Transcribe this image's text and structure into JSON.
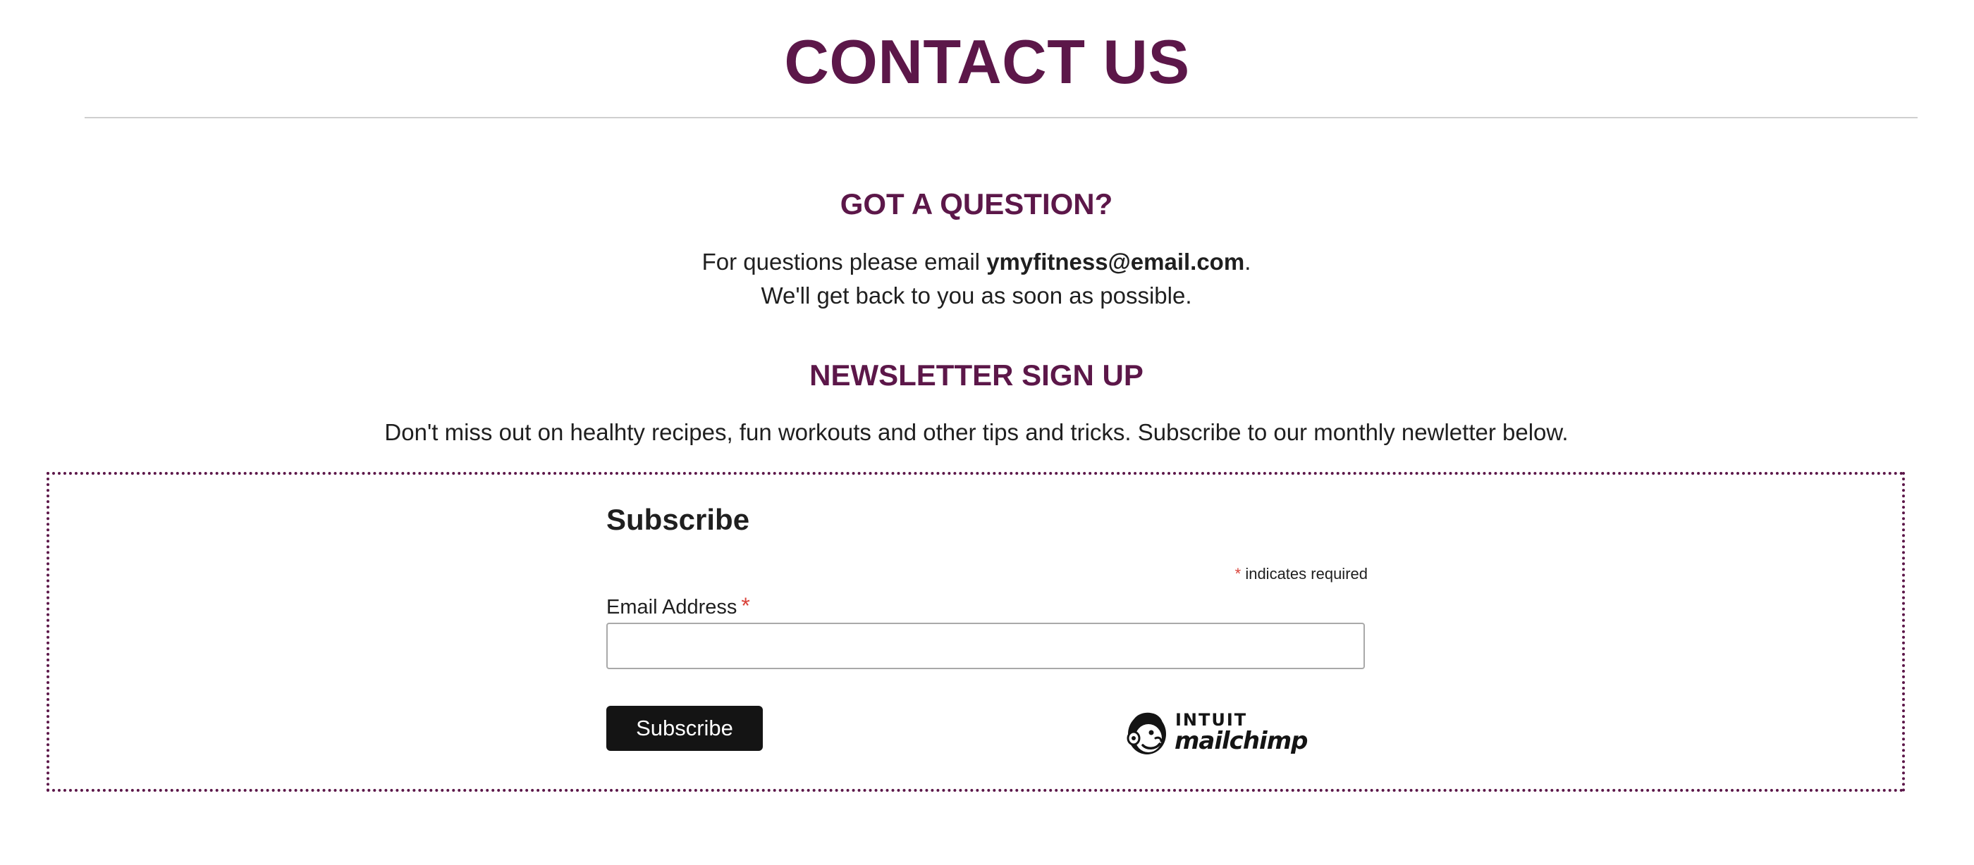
{
  "page": {
    "title": "CONTACT US"
  },
  "question_section": {
    "heading": "GOT A QUESTION?",
    "line1_prefix": "For questions please email ",
    "email": "ymyfitness@email.com",
    "line1_suffix": ".",
    "line2": "We'll get back to you as soon as possible."
  },
  "newsletter_section": {
    "heading": "NEWSLETTER SIGN UP",
    "description": "Don't miss out on healhty recipes, fun workouts and other tips and tricks. Subscribe to our monthly newletter below."
  },
  "signup_form": {
    "heading": "Subscribe",
    "required_marker": "*",
    "required_note": "indicates required",
    "email_label": "Email Address",
    "email_required_marker": "*",
    "email_value": "",
    "email_placeholder": "",
    "submit_label": "Subscribe",
    "badge": {
      "brand_top": "INTUIT",
      "brand_bottom": "mailchimp",
      "icon": "mailchimp-freddie-icon"
    }
  },
  "colors": {
    "brand_plum": "#5c1749",
    "required_red": "#d9433a",
    "button_black": "#141414",
    "divider_gray": "#cfcfcf"
  }
}
